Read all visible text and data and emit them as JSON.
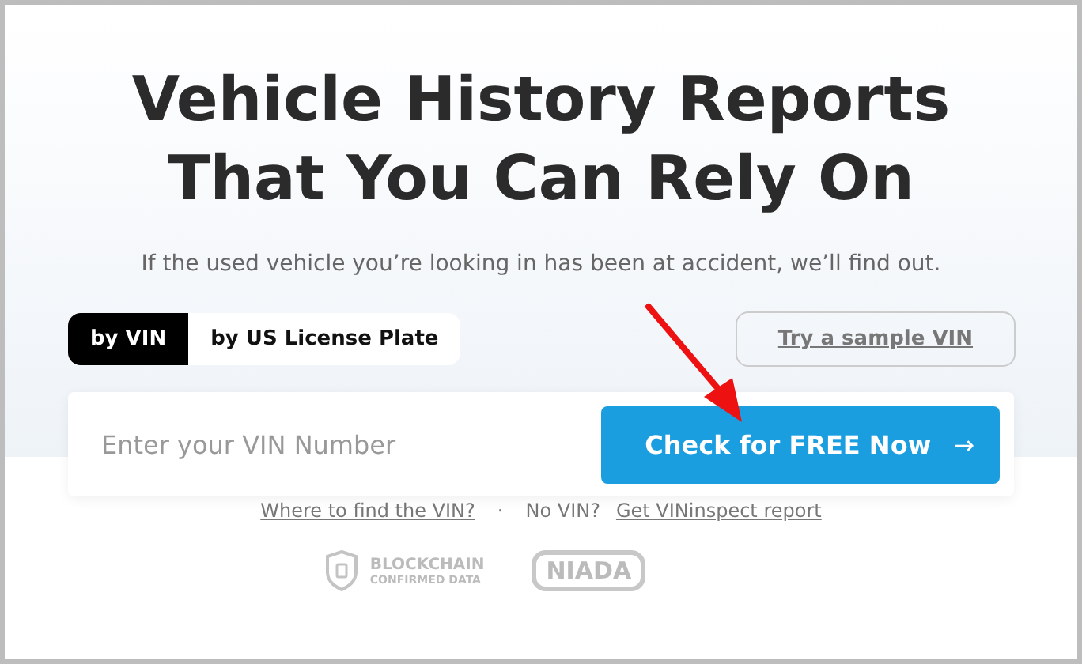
{
  "hero": {
    "title_lines": [
      "Vehicle History Reports",
      "That You Can Rely On"
    ],
    "subtitle": "If the used vehicle you’re looking in has been at accident, we’ll find out."
  },
  "tabs": [
    {
      "label": "by VIN",
      "selected": true
    },
    {
      "label": "by US License Plate",
      "selected": false
    }
  ],
  "sample_link": "Try a sample VIN",
  "search": {
    "placeholder": "Enter your VIN Number",
    "button": "Check for FREE Now",
    "button_icon": "→"
  },
  "help": {
    "where_link": "Where to find the VIN?",
    "separator": "·",
    "no_vin": "No VIN?",
    "report_link": "Get VINinspect report"
  },
  "badges": [
    {
      "kind": "blockchain",
      "lines": [
        "BLOCKCHAIN",
        "CONFIRMED DATA"
      ]
    },
    {
      "kind": "niada",
      "lines": [
        "NIADA"
      ]
    }
  ]
}
